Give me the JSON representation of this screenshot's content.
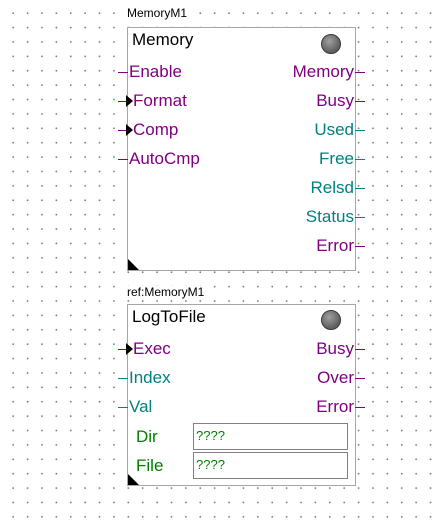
{
  "block1": {
    "instance_label": "MemoryM1",
    "title": "Memory",
    "inputs": [
      "Enable",
      "Format",
      "Comp",
      "AutoCmp"
    ],
    "outputs": [
      "Memory",
      "Busy",
      "Used",
      "Free",
      "Relsd",
      "Status",
      "Error"
    ]
  },
  "block2": {
    "instance_label": "ref:MemoryM1",
    "title": "LogToFile",
    "inputs": [
      "Exec",
      "Index",
      "Val"
    ],
    "outputs": [
      "Busy",
      "Over",
      "Error"
    ],
    "params": [
      {
        "label": "Dir",
        "value": "????"
      },
      {
        "label": "File",
        "value": "????"
      }
    ]
  },
  "colors": {
    "pin_purple": "#800080",
    "pin_teal": "#008080",
    "param_green": "#008000",
    "status_led": "#707070"
  },
  "icons": [
    "status-led-icon",
    "edge-trigger-arrow-icon",
    "block-corner-icon"
  ]
}
